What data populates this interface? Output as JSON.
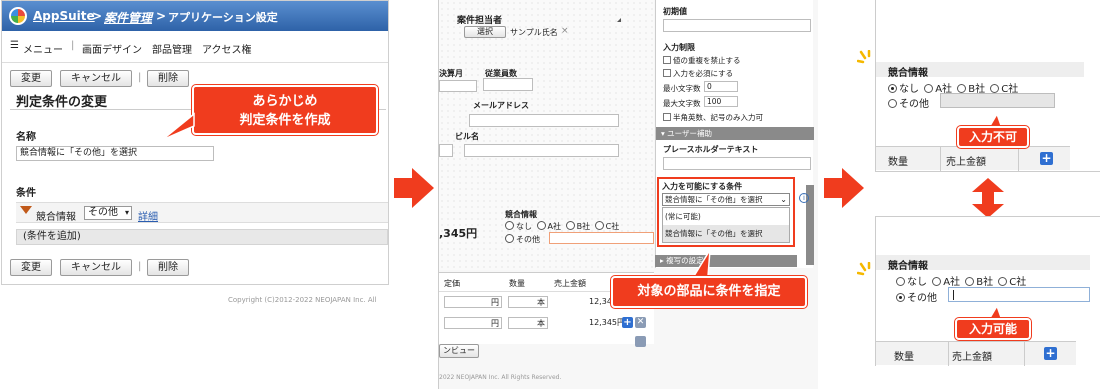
{
  "panel1": {
    "brand": "AppSuite",
    "bc_sep1": ">",
    "bc_link": "案件管理",
    "bc_sep2": ">",
    "bc_current": "アプリケーション設定",
    "menu_icon": "list-icon",
    "menu": [
      "メニュー",
      "画面デザイン",
      "部品管理",
      "アクセス権"
    ],
    "menu_sep": "|",
    "buttons": {
      "change": "変更",
      "cancel": "キャンセル",
      "delete": "削除"
    },
    "page_title": "判定条件の変更",
    "callout": [
      "あらかじめ",
      "判定条件を作成"
    ],
    "name_label": "名称",
    "name_value": "競合情報に「その他」を選択",
    "cond_label": "条件",
    "cond_field": "競合情報",
    "cond_select": "その他",
    "cond_detail": "詳細",
    "cond_add": "(条件を追加)",
    "copyright": "Copyright (C)2012-2022 NEOJAPAN Inc. All"
  },
  "panel2": {
    "f_owner": "案件担当者",
    "owner_select": "選択",
    "owner_user": "サンプル氏名",
    "owner_remove": "×",
    "f_fiscal": "決算月",
    "f_employees": "従業員数",
    "f_email": "メールアドレス",
    "f_building": "ビル名",
    "amount": ",345円",
    "comp_label": "競合情報",
    "comp_options": [
      "なし",
      "A社",
      "B社",
      "C社"
    ],
    "comp_other": "その他",
    "tbl_headers": [
      "定価",
      "数量",
      "売上金額"
    ],
    "row_unit1": "円",
    "row_unit2": "本",
    "row_amounts": [
      "12,345円",
      "12,345円"
    ],
    "preview_btn": "ンビュー",
    "footer": "2022 NEOJAPAN Inc. All Rights Reserved.",
    "prop_initial": "初期値",
    "prop_limit": "入力制限",
    "prop_checks": [
      "値の重複を禁止する",
      "入力を必須にする"
    ],
    "prop_min_label": "最小文字数",
    "prop_min_val": "0",
    "prop_max_label": "最大文字数",
    "prop_max_val": "100",
    "prop_alnum": "半角英数、記号のみ入力可",
    "prop_section": "ユーザー補助",
    "prop_placeholder": "プレースホルダーテキスト",
    "prop_enable": "入力を可能にする条件",
    "prop_enable_value": "競合情報に「その他」を選択",
    "dropdown_options": [
      "(常に可能)",
      "競合情報に「その他」を選択"
    ],
    "prop_copy": "複写の設定",
    "callout": "対象の部品に条件を指定"
  },
  "panel3": {
    "comp_label": "競合情報",
    "options": [
      "なし",
      "A社",
      "B社",
      "C社"
    ],
    "other": "その他",
    "callout_top": "入力不可",
    "tbl_qty": "数量",
    "tbl_sales": "売上金額",
    "callout_bottom": "入力可能"
  },
  "colors": {
    "accent": "#f03c1e",
    "header_blue": "#3a6fb5",
    "plus_blue": "#2f6fd1"
  }
}
